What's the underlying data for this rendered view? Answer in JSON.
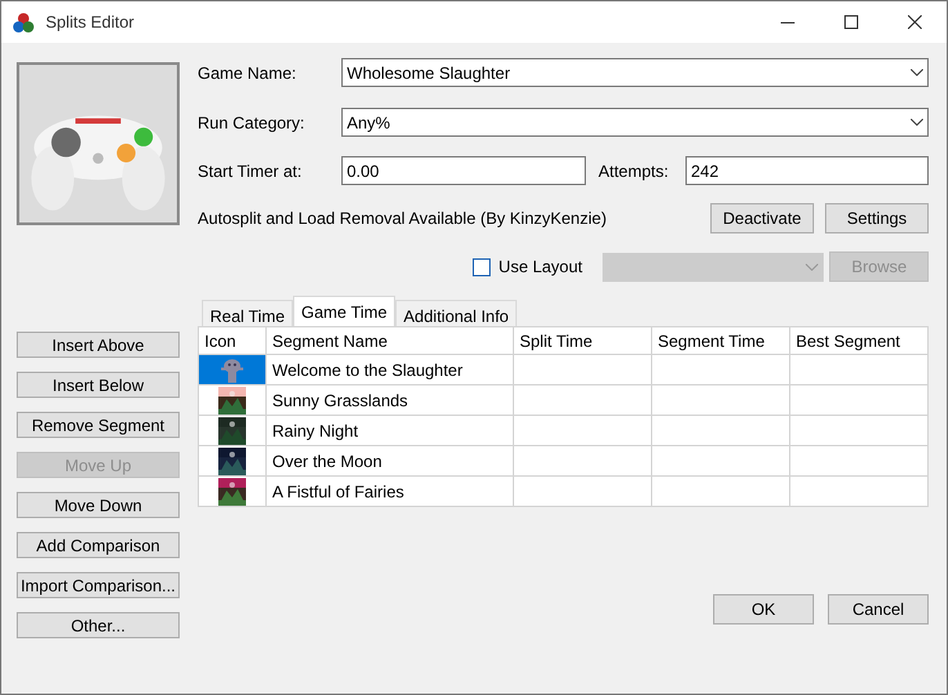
{
  "window": {
    "title": "Splits Editor"
  },
  "game_name": {
    "label": "Game Name:",
    "value": "Wholesome Slaughter"
  },
  "run_category": {
    "label": "Run Category:",
    "value": "Any%"
  },
  "start_timer": {
    "label": "Start Timer at:",
    "value": "0.00"
  },
  "attempts": {
    "label": "Attempts:",
    "value": "242"
  },
  "autosplit": {
    "text": "Autosplit and Load Removal Available (By KinzyKenzie)",
    "buttons": [
      "Deactivate",
      "Settings"
    ]
  },
  "use_layout": {
    "label": "Use Layout",
    "checked": false,
    "browse": "Browse",
    "disabled": true
  },
  "tabs": [
    {
      "label": "Real Time",
      "selected": false
    },
    {
      "label": "Game Time",
      "selected": true
    },
    {
      "label": "Additional Info",
      "selected": false
    }
  ],
  "table": {
    "columns": [
      "Icon",
      "Segment Name",
      "Split Time",
      "Segment Time",
      "Best Segment"
    ],
    "rows": [
      {
        "name": "Welcome to the Slaughter",
        "selected": true
      },
      {
        "name": "Sunny Grasslands",
        "selected": false
      },
      {
        "name": "Rainy Night",
        "selected": false
      },
      {
        "name": "Over the Moon",
        "selected": false
      },
      {
        "name": "A Fistful of Fairies",
        "selected": false
      }
    ]
  },
  "side_buttons": [
    {
      "label": "Insert Above",
      "disabled": false
    },
    {
      "label": "Insert Below",
      "disabled": false
    },
    {
      "label": "Remove Segment",
      "disabled": false
    },
    {
      "label": "Move Up",
      "disabled": true
    },
    {
      "label": "Move Down",
      "disabled": false
    },
    {
      "label": "Add Comparison",
      "disabled": false
    },
    {
      "label": "Import Comparison...",
      "disabled": false
    },
    {
      "label": "Other...",
      "disabled": false
    }
  ],
  "dialog_buttons": [
    "OK",
    "Cancel"
  ]
}
